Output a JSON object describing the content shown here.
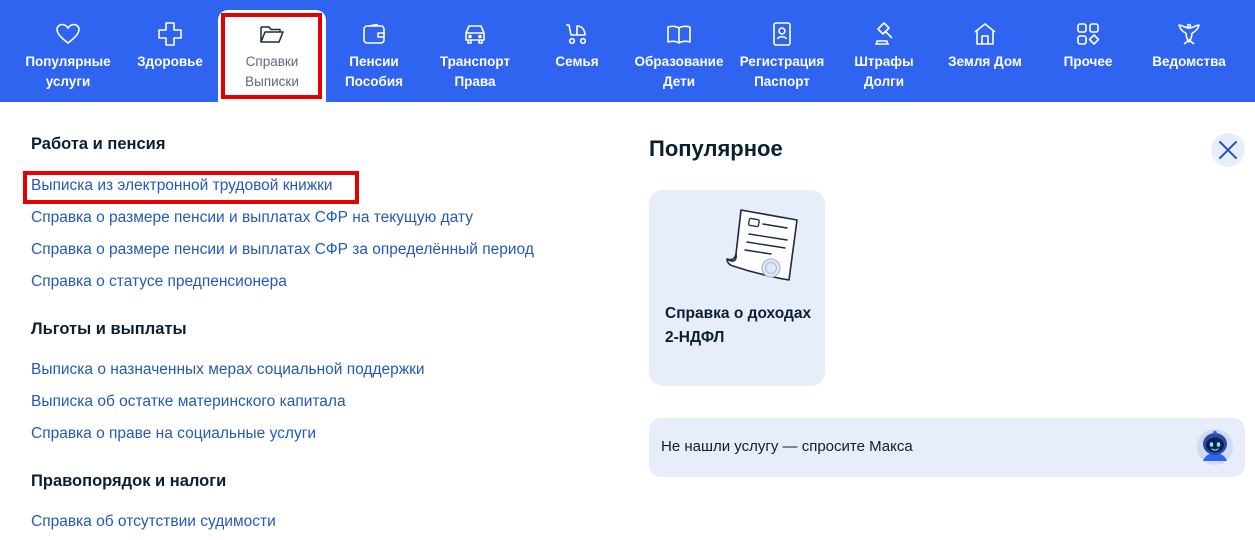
{
  "nav": {
    "items": [
      {
        "line1": "Популярные",
        "line2": "услуги",
        "icon": "heart-icon"
      },
      {
        "line1": "Здоровье",
        "line2": "",
        "icon": "health-cross-icon"
      },
      {
        "line1": "Справки",
        "line2": "Выписки",
        "icon": "folder-icon",
        "active": true
      },
      {
        "line1": "Пенсии",
        "line2": "Пособия",
        "icon": "wallet-icon"
      },
      {
        "line1": "Транспорт",
        "line2": "Права",
        "icon": "car-icon"
      },
      {
        "line1": "Семья",
        "line2": "",
        "icon": "stroller-icon"
      },
      {
        "line1": "Образование",
        "line2": "Дети",
        "icon": "book-icon"
      },
      {
        "line1": "Регистрация",
        "line2": "Паспорт",
        "icon": "passport-icon"
      },
      {
        "line1": "Штрафы",
        "line2": "Долги",
        "icon": "gavel-icon"
      },
      {
        "line1": "Земля Дом",
        "line2": "",
        "icon": "house-icon"
      },
      {
        "line1": "Прочее",
        "line2": "",
        "icon": "grid-icon"
      },
      {
        "line1": "Ведомства",
        "line2": "",
        "icon": "emblem-icon"
      }
    ]
  },
  "sections": [
    {
      "title": "Работа и пенсия",
      "links": [
        "Выписка из электронной трудовой книжки",
        "Справка о размере пенсии и выплатах СФР на текущую дату",
        "Справка о размере пенсии и выплатах СФР за определённый период",
        "Справка о статусе предпенсионера"
      ]
    },
    {
      "title": "Льготы и выплаты",
      "links": [
        "Выписка о назначенных мерах социальной поддержки",
        "Выписка об остатке материнского капитала",
        "Справка о праве на социальные услуги"
      ]
    },
    {
      "title": "Правопорядок и налоги",
      "links": [
        "Справка об отсутствии судимости"
      ]
    }
  ],
  "popular": {
    "title": "Популярное",
    "card": {
      "line1": "Справка о доходах",
      "line2": "2-НДФЛ"
    }
  },
  "ask": {
    "text": "Не нашли услугу — спросите Макса"
  },
  "colors": {
    "nav_bg": "#2f64f0",
    "link": "#2459b8",
    "card_bg": "#e7eef9",
    "highlight": "#e60000"
  }
}
